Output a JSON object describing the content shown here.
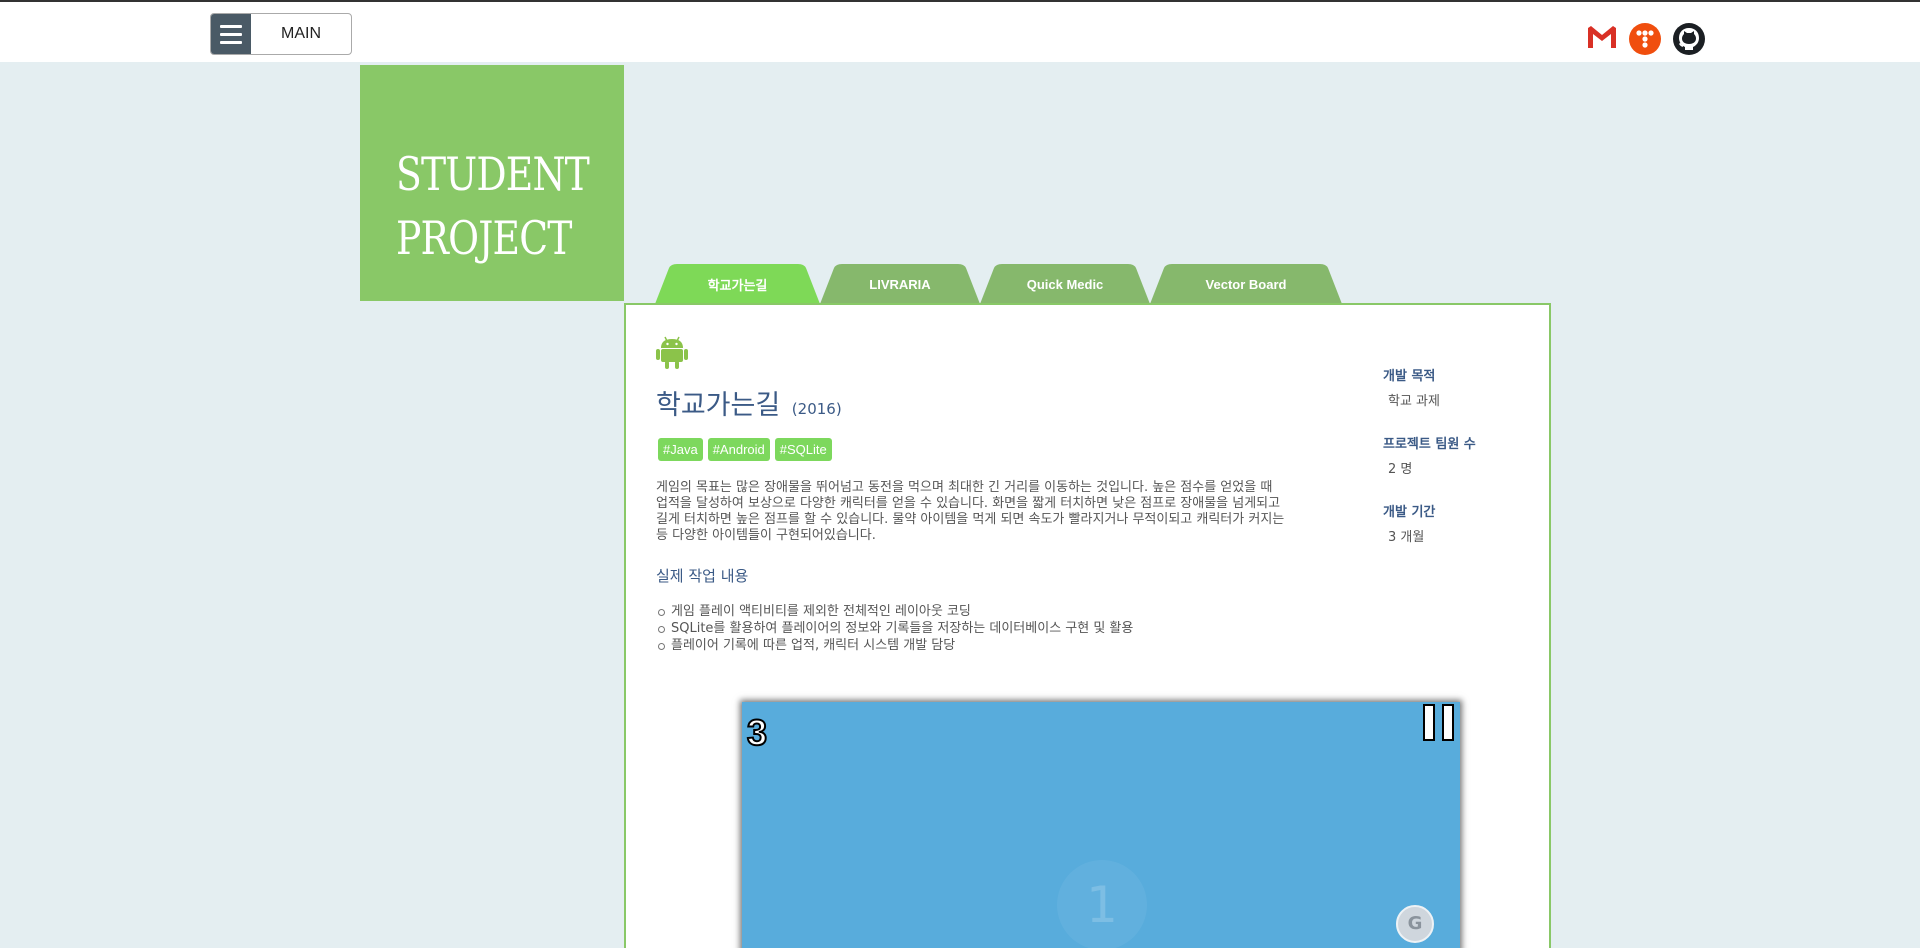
{
  "header": {
    "menu_label": "MAIN",
    "icons": [
      "gmail-icon",
      "tistory-icon",
      "github-icon"
    ]
  },
  "hero": {
    "line1": "STUDENT",
    "line2": "PROJECT",
    "color": "#89c867"
  },
  "tabs": [
    {
      "label": "학교가는길",
      "active": true
    },
    {
      "label": "LIVRARIA",
      "active": false
    },
    {
      "label": "Quick Medic",
      "active": false
    },
    {
      "label": "Vector Board",
      "active": false
    }
  ],
  "project": {
    "platform_icon": "android-icon",
    "title": "학교가는길",
    "year": "(2016)",
    "tags": [
      "#Java",
      "#Android",
      "#SQLite"
    ],
    "description": "게임의 목표는 많은 장애물을 뛰어넘고 동전을 먹으며 최대한 긴 거리를 이동하는 것입니다. 높은 점수를 얻었을 때 업적을 달성하여 보상으로 다양한 캐릭터를 얻을 수 있습니다. 화면을 짧게 터치하면 낮은 점프로 장애물을 넘게되고 길게 터치하면 높은 점프를 할 수 있습니다. 물약 아이템을 먹게 되면 속도가 빨라지거나 무적이되고 캐릭터가 커지는등 다양한 아이템들이 구현되어있습니다.",
    "work_heading": "실제 작업 내용",
    "work_items": [
      "게임 플레이 액티비티를 제외한 전체적인 레이아웃 코딩",
      "SQLite를 활용하여 플레이어의 정보와 기록들을 저장하는 데이터베이스 구현 및 활용",
      "플레이어 기록에 따른 업적, 캐릭터 시스템 개발 담당"
    ]
  },
  "sidebar": {
    "purpose_label": "개발 목적",
    "purpose_value": "학교 과제",
    "team_label": "프로젝트 팀원 수",
    "team_value": "2 명",
    "period_label": "개발 기간",
    "period_value": "3 개월"
  },
  "game_screenshot": {
    "score": "3",
    "ghost_number": "1",
    "coin_letter": "G",
    "background": "#58acdc"
  }
}
